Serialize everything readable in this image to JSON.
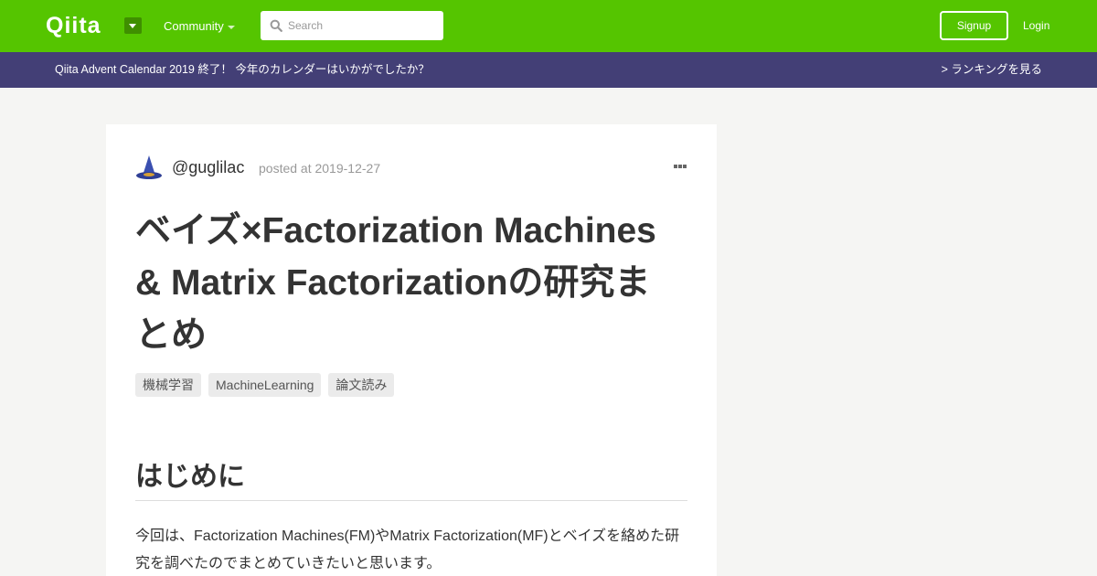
{
  "header": {
    "logo_text": "Qiita",
    "community_label": "Community",
    "search_placeholder": "Search",
    "signup_label": "Signup",
    "login_label": "Login"
  },
  "banner": {
    "text": "Qiita Advent Calendar 2019 終了！ 今年のカレンダーはいかがでしたか？",
    "link_text": "> ランキングを見る"
  },
  "article": {
    "author": "@guglilac",
    "posted_at": "posted at 2019-12-27",
    "title": "ベイズ×Factorization Machines & Matrix Factorizationの研究まとめ",
    "tags": [
      "機械学習",
      "MachineLearning",
      "論文読み"
    ],
    "section_heading": "はじめに",
    "intro": "今回は、Factorization Machines(FM)やMatrix Factorization(MF)とベイズを絡めた研究を調べたのでまとめていきたいと思います。"
  },
  "colors": {
    "header_green": "#55c500",
    "banner_purple": "#433f76",
    "page_background": "#f5f5f3"
  }
}
